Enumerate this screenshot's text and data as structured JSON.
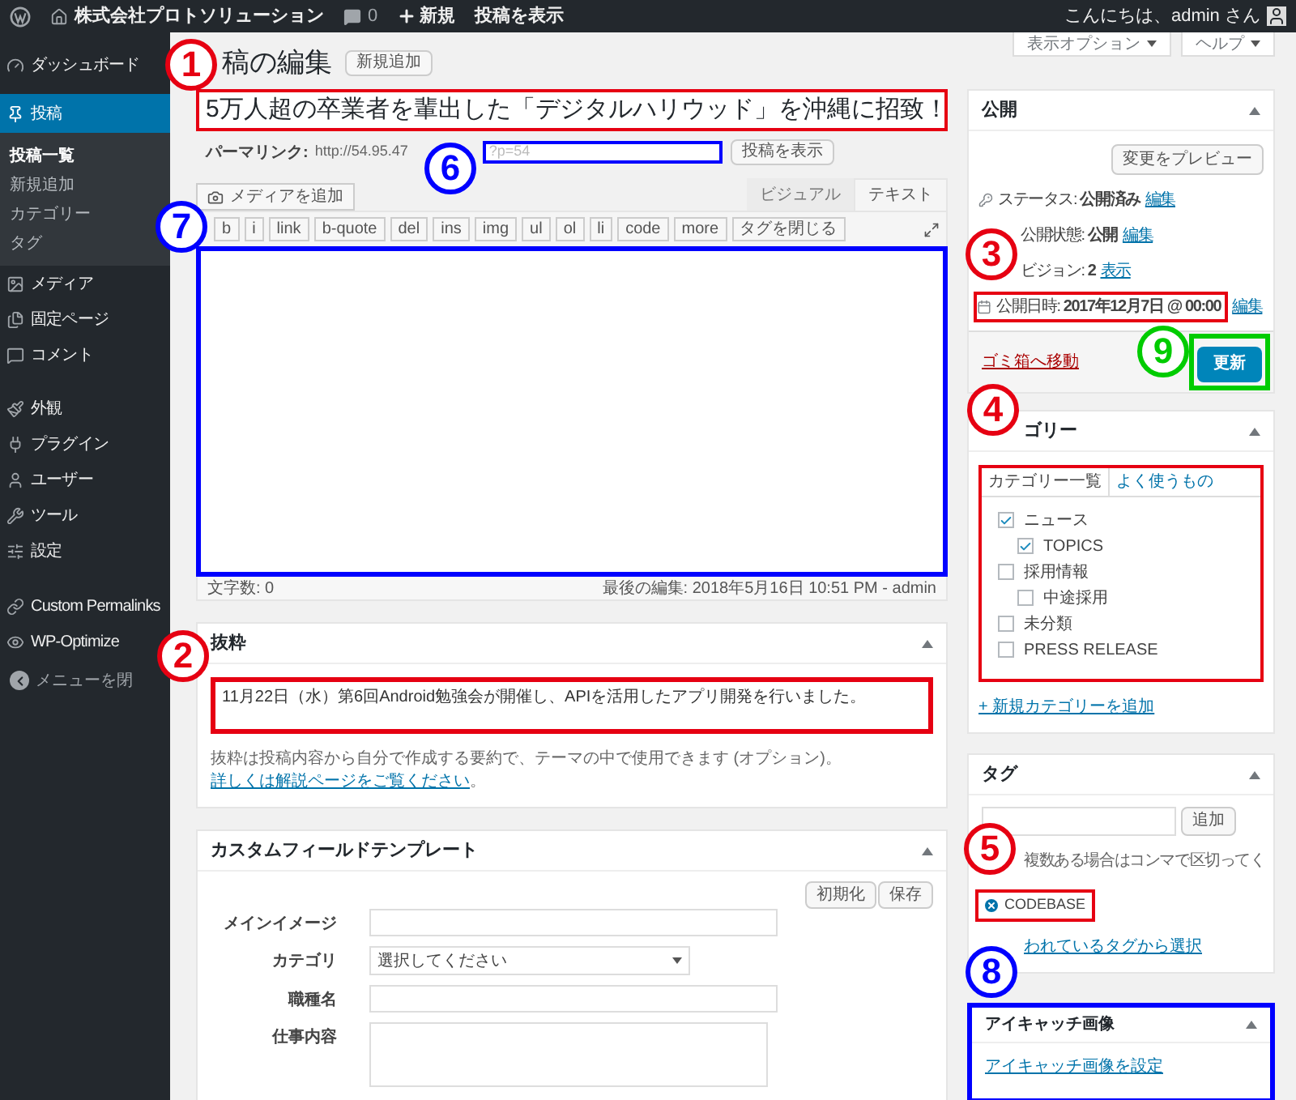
{
  "admin_bar": {
    "site_name": "株式会社プロトソリューション",
    "comments": "0",
    "new": "新規",
    "view_post": "投稿を表示",
    "greeting": "こんにちは、admin さん"
  },
  "sidebar": {
    "groups": [
      [
        {
          "label": "ダッシュボード",
          "selected": false
        }
      ],
      [
        {
          "label": "投稿",
          "selected": true,
          "children": [
            {
              "label": "投稿一覧",
              "selected": true
            },
            {
              "label": "新規追加",
              "selected": false
            },
            {
              "label": "カテゴリー",
              "selected": false
            },
            {
              "label": "タグ",
              "selected": false
            }
          ]
        },
        {
          "label": "メディア",
          "selected": false
        },
        {
          "label": "固定ページ",
          "selected": false
        },
        {
          "label": "コメント",
          "selected": false
        }
      ],
      [
        {
          "label": "外観",
          "selected": false
        },
        {
          "label": "プラグイン",
          "selected": false
        },
        {
          "label": "ユーザー",
          "selected": false
        },
        {
          "label": "ツール",
          "selected": false
        },
        {
          "label": "設定",
          "selected": false
        }
      ],
      [
        {
          "label": "Custom Permalinks",
          "selected": false
        },
        {
          "label": "WP-Optimize",
          "selected": false
        }
      ]
    ],
    "collapse": "メニューを閉"
  },
  "screen_meta": [
    "表示オプション",
    "ヘルプ"
  ],
  "header": {
    "title": "稿の編集",
    "add_new": "新規追加"
  },
  "post": {
    "title": "5万人超の卒業者を輩出した「デジタルハリウッド」を沖縄に招致！",
    "permalink_label": "パーマリンク:",
    "permalink_url": "http://54.95.47",
    "slug": "?p=54",
    "view_button": "投稿を表示"
  },
  "editor": {
    "media_button": "メディアを追加",
    "tabs": [
      {
        "label": "ビジュアル",
        "selected": false
      },
      {
        "label": "テキスト",
        "selected": true
      }
    ],
    "quicktags": [
      "b",
      "i",
      "link",
      "b-quote",
      "del",
      "ins",
      "img",
      "ul",
      "ol",
      "li",
      "code",
      "more",
      "タグを閉じる"
    ],
    "word_count": "文字数: 0",
    "last_edit": "最後の編集: 2018年5月16日 10:51 PM - admin"
  },
  "excerpt": {
    "title": "抜粋",
    "value": "11月22日（水）第6回Android勉強会が開催し、APIを活用したアプリ開発を行いました。",
    "help": "抜粋は投稿内容から自分で作成する要約で、テーマの中で使用できます (オプション)。",
    "link": "詳しくは解説ページをご覧ください",
    "suffix": "。"
  },
  "custom_fields": {
    "title": "カスタムフィールドテンプレート",
    "buttons": [
      "初期化",
      "保存"
    ],
    "fields": [
      {
        "kind": "text",
        "label": "メインイメージ"
      },
      {
        "kind": "select",
        "label": "カテゴリ",
        "value": "選択してください"
      },
      {
        "kind": "text",
        "label": "職種名"
      },
      {
        "kind": "textarea",
        "label": "仕事内容"
      }
    ]
  },
  "publish": {
    "title": "公開",
    "preview": "変更をプレビュー",
    "rows": [
      {
        "label": "ステータス:",
        "value": "公開済み",
        "link": "編集"
      },
      {
        "label": "公開状態:",
        "value": "公開",
        "link": "編集"
      },
      {
        "label": "ビジョン:",
        "value": "2",
        "link": "表示"
      },
      {
        "label": "公開日時:",
        "value": "2017年12月7日 @ 00:00",
        "link": "編集"
      }
    ],
    "trash": "ゴミ箱へ移動",
    "update": "更新"
  },
  "categories": {
    "title": "ゴリー",
    "tabs": [
      {
        "label": "カテゴリー一覧",
        "selected": true
      },
      {
        "label": "よく使うもの",
        "selected": false
      }
    ],
    "items": [
      {
        "label": "ニュース",
        "checked": true,
        "children": [
          {
            "label": "TOPICS",
            "checked": true
          }
        ]
      },
      {
        "label": "採用情報",
        "checked": false,
        "children": [
          {
            "label": "中途採用",
            "checked": false
          }
        ]
      },
      {
        "label": "未分類",
        "checked": false
      },
      {
        "label": "PRESS RELEASE",
        "checked": false
      }
    ],
    "add_link": "+ 新規カテゴリーを追加"
  },
  "tags": {
    "title": "タグ",
    "add": "追加",
    "hint": "複数ある場合はコンマで区切ってく",
    "items": [
      "CODEBASE"
    ],
    "cloud_link": "われているタグから選択"
  },
  "featured_image": {
    "title": "アイキャッチ画像",
    "link": "アイキャッチ画像を設定"
  },
  "annotations": [
    {
      "number": "1",
      "color": "#e60012"
    },
    {
      "number": "2",
      "color": "#e60012"
    },
    {
      "number": "3",
      "color": "#e60012"
    },
    {
      "number": "4",
      "color": "#e60012"
    },
    {
      "number": "5",
      "color": "#e60012"
    },
    {
      "number": "6",
      "color": "#0000ff"
    },
    {
      "number": "7",
      "color": "#0000ff"
    },
    {
      "number": "8",
      "color": "#0000ff"
    },
    {
      "number": "9",
      "color": "#00cc00"
    }
  ]
}
